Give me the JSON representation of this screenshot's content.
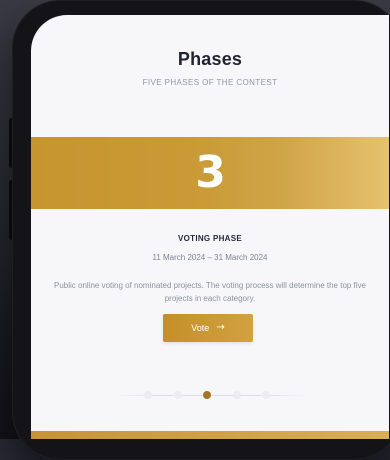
{
  "header": {
    "title": "Phases",
    "subtitle": "FIVE PHASES OF THE CONTEST"
  },
  "phase": {
    "number": "3",
    "name": "VOTING PHASE",
    "dates": "11 March 2024 – 31 March 2024",
    "description": "Public online voting of nominated projects. The voting process will determine the top five projects in each category.",
    "cta_label": "Vote",
    "cta_icon": "arrow-right-icon",
    "cta_icon_glyph": "→"
  },
  "pager": {
    "total": 5,
    "active_index": 3
  },
  "colors": {
    "accent_gold": "#c9982f",
    "accent_gold_light": "#e6c26f",
    "dot_active": "#a17724",
    "screen_bg": "#f7f7f9",
    "title_text": "#1f2330"
  }
}
